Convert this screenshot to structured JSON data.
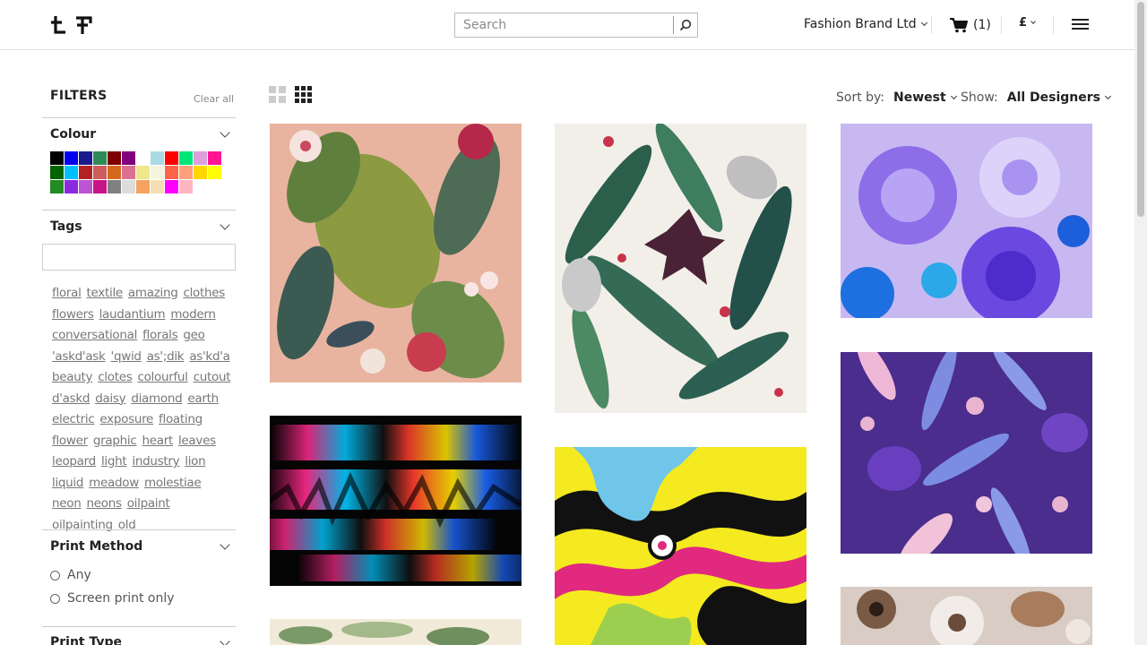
{
  "header": {
    "search_placeholder": "Search",
    "account_label": "Fashion Brand Ltd",
    "cart_label": "(1)",
    "currency_label": "£"
  },
  "filters": {
    "title": "FILTERS",
    "clear_all": "Clear all",
    "colour": {
      "heading": "Colour",
      "swatches": [
        "#000000",
        "#0000ee",
        "#1a1a8c",
        "#2e8b57",
        "#800000",
        "#800080",
        "#ffffff",
        "#a8dbe6",
        "#ff0000",
        "#00e676",
        "#dda0dd",
        "#ff1493",
        "#006400",
        "#00bfff",
        "#b22222",
        "#cd5c5c",
        "#d2691e",
        "#db7093",
        "#f0e68c",
        "#f5f5dc",
        "#ff6347",
        "#ffa07a",
        "#ffd700",
        "#ffff00",
        "#228b22",
        "#8a2be2",
        "#ba55d3",
        "#c71585",
        "#808080",
        "#dcdcdc",
        "#f4a460",
        "#f5deb3",
        "#ff00ff",
        "#ffb6c1"
      ]
    },
    "tags": {
      "heading": "Tags",
      "items": [
        "floral",
        "textile",
        "amazing",
        "clothes",
        "flowers",
        "laudantium",
        "modern",
        "conversational",
        "florals",
        "geo",
        "'askd'ask",
        "'qwid",
        "as';dik",
        "as'kd'a",
        "beauty",
        "clotes",
        "colourful",
        "cutout",
        "d'askd",
        "daisy",
        "diamond",
        "earth",
        "electric",
        "exposure",
        "floating",
        "flower",
        "graphic",
        "heart",
        "leaves",
        "leopard",
        "light",
        "industry",
        "lion",
        "liquid",
        "meadow",
        "molestiae",
        "neon",
        "neons",
        "oilpaint",
        "oilpainting",
        "old"
      ]
    },
    "print_method": {
      "heading": "Print Method",
      "options": [
        "Any",
        "Screen print only"
      ]
    },
    "print_type": {
      "heading": "Print Type"
    }
  },
  "toolbar": {
    "sort_label": "Sort by:",
    "sort_value": "Newest",
    "show_label": "Show:",
    "show_value": "All Designers"
  },
  "colors": {
    "accent": "#222222",
    "muted_text": "#777777",
    "border": "#cccccc"
  }
}
